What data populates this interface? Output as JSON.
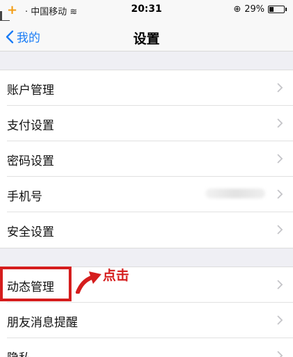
{
  "status_bar": {
    "carrier": "中国移动",
    "time": "20:31",
    "battery_text": "29%",
    "battery_level": 0.29,
    "icons": [
      "signal-icon",
      "wifi-icon",
      "lock-rotation-icon",
      "battery-icon"
    ]
  },
  "nav": {
    "back_label": "我的",
    "title": "设置"
  },
  "groups": [
    {
      "items": [
        "账户管理",
        "支付设置",
        "密码设置",
        "手机号",
        "安全设置"
      ]
    },
    {
      "items": [
        "动态管理",
        "朋友消息提醒",
        "隐私"
      ]
    }
  ],
  "annotation": {
    "text": "点击",
    "color": "#d51d1d"
  },
  "colors": {
    "accent": "#1a7cf5",
    "background": "#efeff4"
  }
}
